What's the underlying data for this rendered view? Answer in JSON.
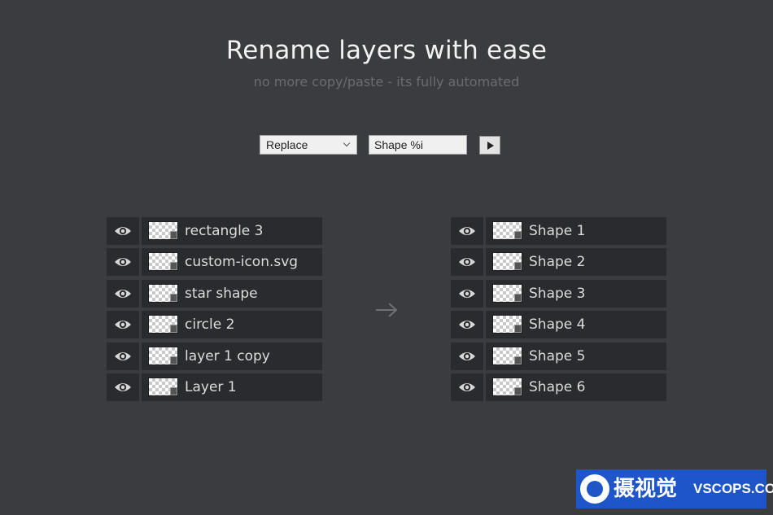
{
  "header": {
    "title": "Rename layers with ease",
    "subtitle": "no more copy/paste - its fully automated"
  },
  "controls": {
    "mode_selected": "Replace",
    "pattern_value": "Shape %i"
  },
  "before_layers": [
    {
      "name": "rectangle 3"
    },
    {
      "name": "custom-icon.svg"
    },
    {
      "name": "star shape"
    },
    {
      "name": "circle 2"
    },
    {
      "name": "layer 1 copy"
    },
    {
      "name": "Layer 1"
    }
  ],
  "after_layers": [
    {
      "name": "Shape 1"
    },
    {
      "name": "Shape 2"
    },
    {
      "name": "Shape 3"
    },
    {
      "name": "Shape 4"
    },
    {
      "name": "Shape 5"
    },
    {
      "name": "Shape 6"
    }
  ],
  "watermark": {
    "cn_text": "摄视觉",
    "en_text": "VSCOPS.COM"
  },
  "colors": {
    "background": "#3b3c40",
    "row_background": "#2a2b2f",
    "watermark_blue": "#1e55c8"
  }
}
